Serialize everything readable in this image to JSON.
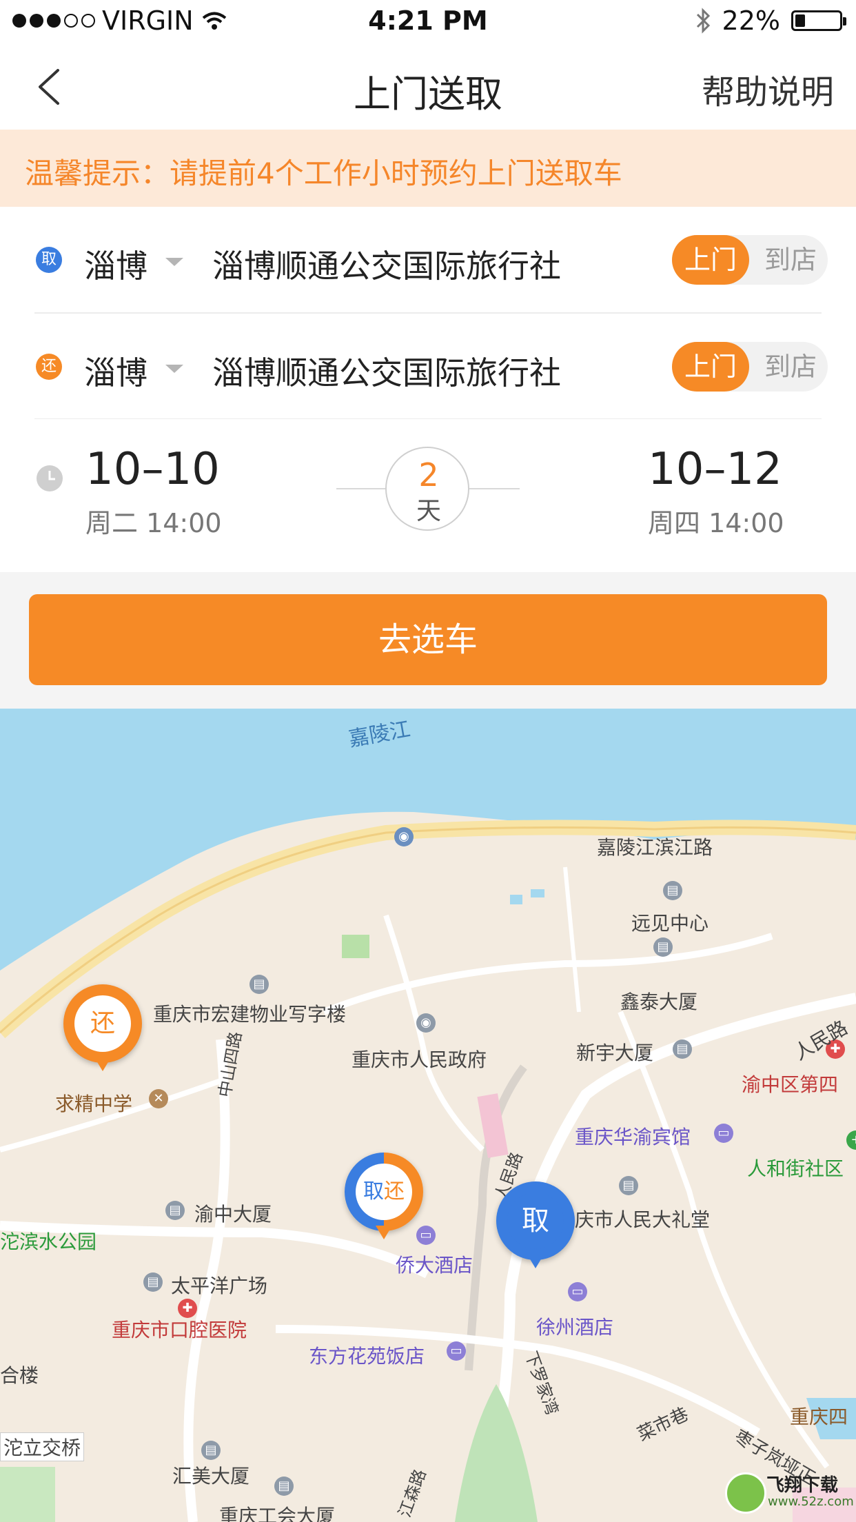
{
  "status_bar": {
    "carrier": "VIRGIN",
    "time": "4:21 PM",
    "battery_percent": "22%",
    "battery_level": 0.22,
    "signal_bars_filled": 3,
    "signal_bars_total": 5,
    "icons": [
      "wifi-icon",
      "bluetooth-icon",
      "battery-icon"
    ]
  },
  "nav": {
    "back_icon": "chevron-left-icon",
    "title": "上门送取",
    "help": "帮助说明"
  },
  "tips": {
    "text": "温馨提示：请提前4个工作小时预约上门送取车"
  },
  "pickup": {
    "badge": "取",
    "badge_color": "#3a7de0",
    "city": "淄博",
    "address": "淄博顺通公交国际旅行社",
    "toggle_on": "上门",
    "toggle_off": "到店"
  },
  "return": {
    "badge": "还",
    "badge_color": "#f68a26",
    "city": "淄博",
    "address": "淄博顺通公交国际旅行社",
    "toggle_on": "上门",
    "toggle_off": "到店"
  },
  "dates": {
    "start_date": "10–10",
    "start_sub": "周二 14:00",
    "duration_num": "2",
    "duration_unit": "天",
    "end_date": "10–12",
    "end_sub": "周四 14:00"
  },
  "action": {
    "select_car": "去选车"
  },
  "colors": {
    "accent": "#f68a26",
    "pickup_blue": "#3a7de0",
    "tips_bg": "#fde9d8",
    "river": "#a4d8ef",
    "map_bg": "#f3ebe0"
  },
  "map": {
    "river_name": "嘉陵江",
    "roads": {
      "riverside": "嘉陵江滨江路",
      "zhongshan": "中山四路",
      "renmin": "人民路",
      "renminlu2": "人民路",
      "xialuojia": "下罗家湾",
      "caishi": "菜市巷",
      "zaozi": "枣子岚垭正",
      "jiangsen": "江森路"
    },
    "places": {
      "yuanjian": "远见中心",
      "xintai": "鑫泰大厦",
      "hongjian": "重庆市宏建物业写字楼",
      "govt": "重庆市人民政府",
      "xinyu": "新宇大厦",
      "yuzhong4": "渝中区第四",
      "qiujing": "求精中学",
      "huayu": "重庆华渝宾馆",
      "renhe": "人和街社区",
      "yuzhong_dasha": "渝中大厦",
      "binjiang": "沱滨水公园",
      "qiaoda": "侨大酒店",
      "renda": "庆市人民大礼堂",
      "taipingyang": "太平洋广场",
      "xuzhou": "徐州酒店",
      "kouqiang": "重庆市口腔医院",
      "dongfang": "东方花苑饭店",
      "helou": "合楼",
      "tuoli": "沱立交桥",
      "huimei": "汇美大厦",
      "chongqing4": "重庆四",
      "gonghui": "重庆工会大厦"
    },
    "pins": {
      "return_pin": "还",
      "combo_pin_left": "取",
      "combo_pin_right": "还",
      "pickup_pin": "取"
    },
    "watermark": {
      "text": "飞翔下载",
      "url": "www.52z.com"
    }
  }
}
